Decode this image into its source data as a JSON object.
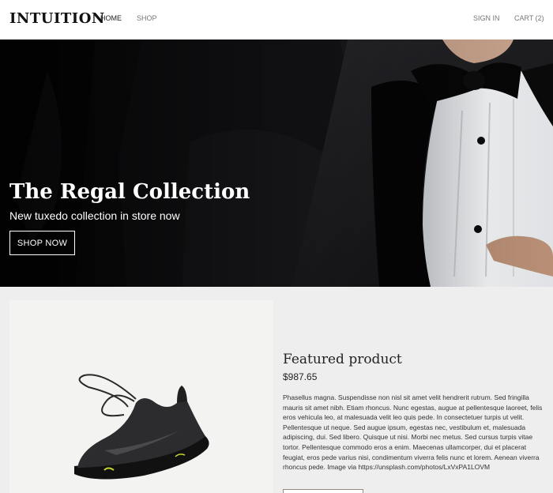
{
  "header": {
    "logo": "INTUITION",
    "nav": {
      "home": "HOME",
      "shop": "SHOP",
      "sign_in": "SIGN IN",
      "cart": "CART (2)"
    }
  },
  "hero": {
    "title": "The Regal Collection",
    "subtitle": "New tuxedo collection in store now",
    "button_label": "SHOP NOW"
  },
  "featured": {
    "heading": "Featured product",
    "price": "$987.65",
    "description": "Phasellus magna. Suspendisse non nisl sit amet velit hendrerit rutrum. Sed fringilla mauris sit amet nibh. Etiam rhoncus. Nunc egestas, augue at pellentesque laoreet, felis eros vehicula leo, at malesuada velit leo quis pede. In consectetuer turpis ut velit. Pellentesque ut neque. Sed augue ipsum, egestas nec, vestibulum et, malesuada adipiscing, dui. Sed libero. Quisque ut nisi. Morbi nec metus. Sed cursus turpis vitae tortor. Pellentesque commodo eros a enim. Maecenas ullamcorper, dui et placerat feugiat, eros pede varius nisi, condimentum viverra felis nunc et lorem. Aenean viverra rhoncus pede. Image via https://unsplash.com/photos/LxVxPA1LOVM"
  },
  "colors": {
    "hero_bg": "#111114",
    "featured_bg": "#eeeeee",
    "accent_sole": "#c8d632"
  }
}
